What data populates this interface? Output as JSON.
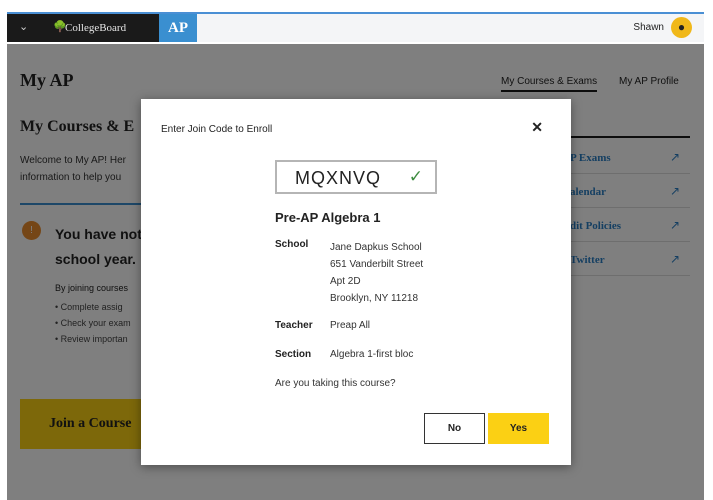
{
  "header": {
    "menu_icon": "chevron-down-icon",
    "logo_icon": "acorn-icon",
    "logo_text": "CollegeBoard",
    "product": "AP",
    "user_name": "Shawn",
    "avatar_icon": "user-icon"
  },
  "page": {
    "title": "My AP",
    "nav": [
      "My Courses & Exams",
      "My AP Profile"
    ],
    "section_title": "My Courses & E",
    "welcome_lines": [
      "Welcome to My AP! Her",
      "information to help you"
    ],
    "alert_icon": "alert-icon",
    "alert_lines": [
      "You have not j",
      "school year."
    ],
    "joining_text": "By joining courses",
    "bullets": [
      "Complete assig",
      "Check your exam",
      "Review importan"
    ],
    "join_button": "Join a Course",
    "quick_links": [
      {
        "label": "P Exams",
        "icon": "arrow-up-right-icon"
      },
      {
        "label": "alendar",
        "icon": "arrow-up-right-icon"
      },
      {
        "label": "dit Policies",
        "icon": "arrow-up-right-icon"
      },
      {
        "label": "Twitter",
        "icon": "arrow-up-right-icon"
      }
    ]
  },
  "modal": {
    "title": "Enter Join Code to Enroll",
    "close_icon": "close-icon",
    "join_code": "MQXNVQ",
    "code_valid_icon": "check-icon",
    "course_name": "Pre-AP Algebra 1",
    "school_label": "School",
    "school_lines": [
      "Jane Dapkus School",
      "651 Vanderbilt Street",
      "Apt 2D",
      "Brooklyn, NY 11218"
    ],
    "teacher_label": "Teacher",
    "teacher": "Preap All",
    "section_label": "Section",
    "section": "Algebra 1-first bloc",
    "question": "Are you taking this course?",
    "no_button": "No",
    "yes_button": "Yes"
  },
  "colors": {
    "accent_blue": "#3a8fd0",
    "accent_yellow": "#fbd014",
    "success_green": "#3d8c40",
    "alert_orange": "#ea8c2c"
  }
}
